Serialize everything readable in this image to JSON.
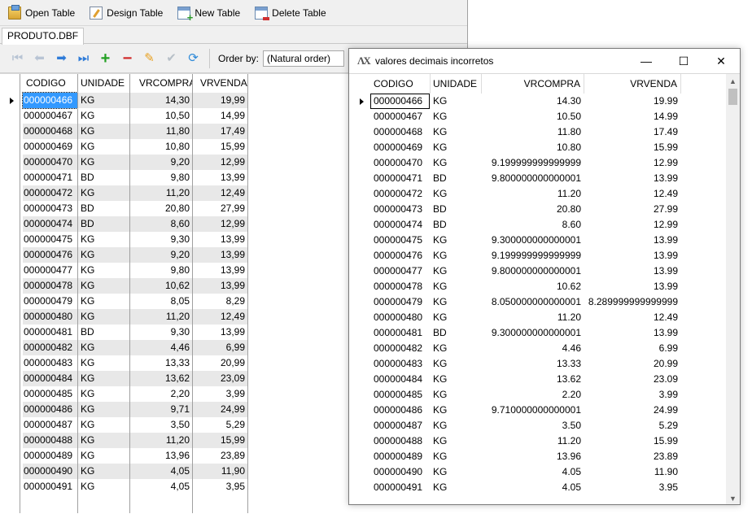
{
  "main": {
    "toolbar": [
      {
        "label": "Open Table",
        "icon": "open-table-icon"
      },
      {
        "label": "Design Table",
        "icon": "design-table-icon"
      },
      {
        "label": "New Table",
        "icon": "new-table-icon"
      },
      {
        "label": "Delete Table",
        "icon": "delete-table-icon"
      }
    ],
    "tab": "PRODUTO.DBF",
    "order_label": "Order by:",
    "order_value": "(Natural order)",
    "columns": [
      "CODIGO",
      "UNIDADE",
      "VRCOMPRA",
      "VRVENDA"
    ],
    "rows": [
      [
        "000000466",
        "KG",
        "14,30",
        "19,99"
      ],
      [
        "000000467",
        "KG",
        "10,50",
        "14,99"
      ],
      [
        "000000468",
        "KG",
        "11,80",
        "17,49"
      ],
      [
        "000000469",
        "KG",
        "10,80",
        "15,99"
      ],
      [
        "000000470",
        "KG",
        "9,20",
        "12,99"
      ],
      [
        "000000471",
        "BD",
        "9,80",
        "13,99"
      ],
      [
        "000000472",
        "KG",
        "11,20",
        "12,49"
      ],
      [
        "000000473",
        "BD",
        "20,80",
        "27,99"
      ],
      [
        "000000474",
        "BD",
        "8,60",
        "12,99"
      ],
      [
        "000000475",
        "KG",
        "9,30",
        "13,99"
      ],
      [
        "000000476",
        "KG",
        "9,20",
        "13,99"
      ],
      [
        "000000477",
        "KG",
        "9,80",
        "13,99"
      ],
      [
        "000000478",
        "KG",
        "10,62",
        "13,99"
      ],
      [
        "000000479",
        "KG",
        "8,05",
        "8,29"
      ],
      [
        "000000480",
        "KG",
        "11,20",
        "12,49"
      ],
      [
        "000000481",
        "BD",
        "9,30",
        "13,99"
      ],
      [
        "000000482",
        "KG",
        "4,46",
        "6,99"
      ],
      [
        "000000483",
        "KG",
        "13,33",
        "20,99"
      ],
      [
        "000000484",
        "KG",
        "13,62",
        "23,09"
      ],
      [
        "000000485",
        "KG",
        "2,20",
        "3,99"
      ],
      [
        "000000486",
        "KG",
        "9,71",
        "24,99"
      ],
      [
        "000000487",
        "KG",
        "3,50",
        "5,29"
      ],
      [
        "000000488",
        "KG",
        "11,20",
        "15,99"
      ],
      [
        "000000489",
        "KG",
        "13,96",
        "23,89"
      ],
      [
        "000000490",
        "KG",
        "4,05",
        "11,90"
      ],
      [
        "000000491",
        "KG",
        "4,05",
        "3,95"
      ]
    ]
  },
  "dialog": {
    "title": "valores decimais incorretos",
    "columns": [
      "CODIGO",
      "UNIDADE",
      "VRCOMPRA",
      "VRVENDA"
    ],
    "rows": [
      [
        "000000466",
        "KG",
        "14.30",
        "19.99"
      ],
      [
        "000000467",
        "KG",
        "10.50",
        "14.99"
      ],
      [
        "000000468",
        "KG",
        "11.80",
        "17.49"
      ],
      [
        "000000469",
        "KG",
        "10.80",
        "15.99"
      ],
      [
        "000000470",
        "KG",
        "9.199999999999999",
        "12.99"
      ],
      [
        "000000471",
        "BD",
        "9.800000000000001",
        "13.99"
      ],
      [
        "000000472",
        "KG",
        "11.20",
        "12.49"
      ],
      [
        "000000473",
        "BD",
        "20.80",
        "27.99"
      ],
      [
        "000000474",
        "BD",
        "8.60",
        "12.99"
      ],
      [
        "000000475",
        "KG",
        "9.300000000000001",
        "13.99"
      ],
      [
        "000000476",
        "KG",
        "9.199999999999999",
        "13.99"
      ],
      [
        "000000477",
        "KG",
        "9.800000000000001",
        "13.99"
      ],
      [
        "000000478",
        "KG",
        "10.62",
        "13.99"
      ],
      [
        "000000479",
        "KG",
        "8.050000000000001",
        "8.289999999999999"
      ],
      [
        "000000480",
        "KG",
        "11.20",
        "12.49"
      ],
      [
        "000000481",
        "BD",
        "9.300000000000001",
        "13.99"
      ],
      [
        "000000482",
        "KG",
        "4.46",
        "6.99"
      ],
      [
        "000000483",
        "KG",
        "13.33",
        "20.99"
      ],
      [
        "000000484",
        "KG",
        "13.62",
        "23.09"
      ],
      [
        "000000485",
        "KG",
        "2.20",
        "3.99"
      ],
      [
        "000000486",
        "KG",
        "9.710000000000001",
        "24.99"
      ],
      [
        "000000487",
        "KG",
        "3.50",
        "5.29"
      ],
      [
        "000000488",
        "KG",
        "11.20",
        "15.99"
      ],
      [
        "000000489",
        "KG",
        "13.96",
        "23.89"
      ],
      [
        "000000490",
        "KG",
        "4.05",
        "11.90"
      ],
      [
        "000000491",
        "KG",
        "4.05",
        "3.95"
      ]
    ]
  },
  "colors": {
    "selection": "#3399ff",
    "alt_row": "#e8e8e8"
  }
}
